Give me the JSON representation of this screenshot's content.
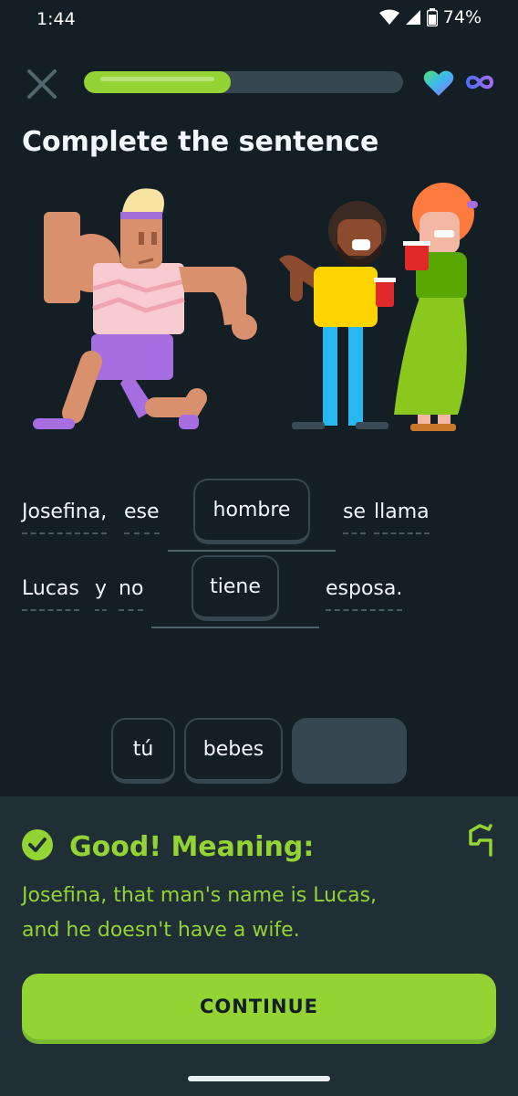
{
  "status_bar": {
    "time": "1:44",
    "battery": "74%"
  },
  "progress": {
    "fraction": 0.46
  },
  "title": "Complete the sentence",
  "sentence": {
    "line1": [
      "Josefina,",
      "ese",
      "se",
      "llama"
    ],
    "line1_blank": "hombre",
    "line2": [
      "Lucas",
      "y",
      "no",
      "esposa."
    ],
    "line2_blank": "tiene"
  },
  "word_bank": [
    "tú",
    "bebes"
  ],
  "feedback": {
    "title": "Good! Meaning:",
    "line1": "Josefina, that man's name is Lucas,",
    "line2": "and he doesn't have a wife.",
    "continue_label": "CONTINUE"
  },
  "colors": {
    "accent": "#93d333",
    "background": "#131f24",
    "panel": "#202f36",
    "chip_border": "#37464f"
  },
  "icons": [
    "close-icon",
    "heart-icon",
    "infinity-icon",
    "check-circle-icon",
    "flag-icon",
    "wifi-icon",
    "signal-icon",
    "battery-icon"
  ]
}
